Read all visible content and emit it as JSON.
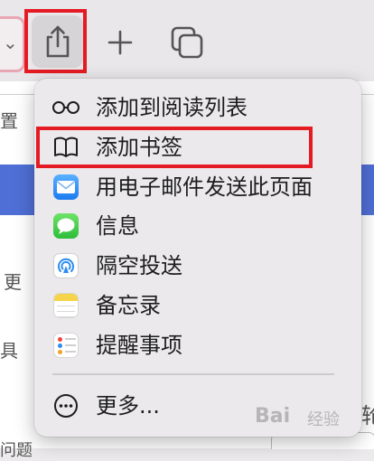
{
  "toolbar": {
    "share_icon": "share-icon",
    "plus_icon": "plus-icon",
    "tabs_icon": "tabs-overview-icon"
  },
  "background": {
    "left_chars": [
      "置",
      "更",
      "具"
    ],
    "right_chars": [
      "轮"
    ],
    "bottom_char": "问题"
  },
  "menu": {
    "items": [
      {
        "label": "添加到阅读列表",
        "icon": "reading-list-icon"
      },
      {
        "label": "添加书签",
        "icon": "bookmark-book-icon"
      },
      {
        "label": "用电子邮件发送此页面",
        "icon": "mail-icon"
      },
      {
        "label": "信息",
        "icon": "messages-icon"
      },
      {
        "label": "隔空投送",
        "icon": "airdrop-icon"
      },
      {
        "label": "备忘录",
        "icon": "notes-icon"
      },
      {
        "label": "提醒事项",
        "icon": "reminders-icon"
      },
      {
        "label": "更多...",
        "icon": "more-ellipsis-icon"
      }
    ]
  },
  "watermark": {
    "text": "Bai",
    "text2": "经验"
  },
  "colors": {
    "highlight": "#e41b23",
    "menu_bg": "#ebe9eb",
    "accent_blue": "#4f6fd6"
  }
}
